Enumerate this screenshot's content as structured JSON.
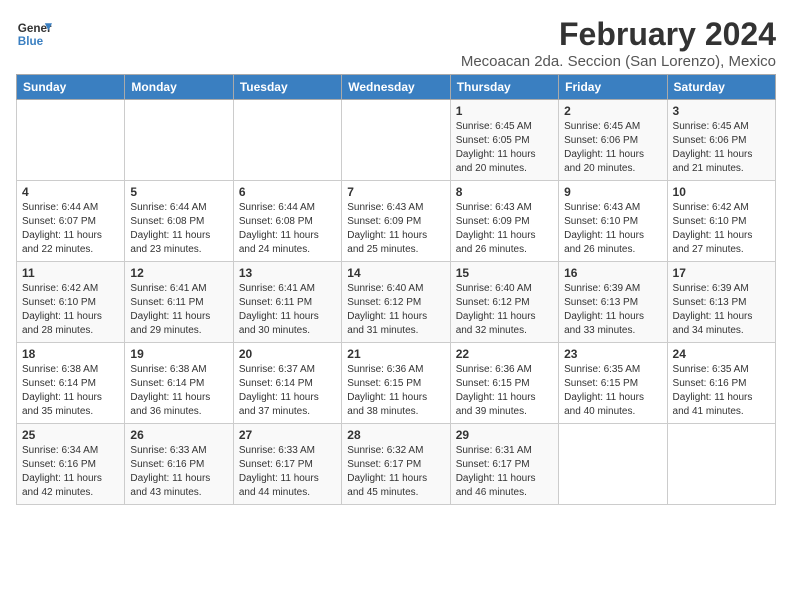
{
  "logo": {
    "line1": "General",
    "line2": "Blue"
  },
  "title": "February 2024",
  "subtitle": "Mecoacan 2da. Seccion (San Lorenzo), Mexico",
  "days_of_week": [
    "Sunday",
    "Monday",
    "Tuesday",
    "Wednesday",
    "Thursday",
    "Friday",
    "Saturday"
  ],
  "weeks": [
    [
      {
        "day": "",
        "info": ""
      },
      {
        "day": "",
        "info": ""
      },
      {
        "day": "",
        "info": ""
      },
      {
        "day": "",
        "info": ""
      },
      {
        "day": "1",
        "info": "Sunrise: 6:45 AM\nSunset: 6:05 PM\nDaylight: 11 hours\nand 20 minutes."
      },
      {
        "day": "2",
        "info": "Sunrise: 6:45 AM\nSunset: 6:06 PM\nDaylight: 11 hours\nand 20 minutes."
      },
      {
        "day": "3",
        "info": "Sunrise: 6:45 AM\nSunset: 6:06 PM\nDaylight: 11 hours\nand 21 minutes."
      }
    ],
    [
      {
        "day": "4",
        "info": "Sunrise: 6:44 AM\nSunset: 6:07 PM\nDaylight: 11 hours\nand 22 minutes."
      },
      {
        "day": "5",
        "info": "Sunrise: 6:44 AM\nSunset: 6:08 PM\nDaylight: 11 hours\nand 23 minutes."
      },
      {
        "day": "6",
        "info": "Sunrise: 6:44 AM\nSunset: 6:08 PM\nDaylight: 11 hours\nand 24 minutes."
      },
      {
        "day": "7",
        "info": "Sunrise: 6:43 AM\nSunset: 6:09 PM\nDaylight: 11 hours\nand 25 minutes."
      },
      {
        "day": "8",
        "info": "Sunrise: 6:43 AM\nSunset: 6:09 PM\nDaylight: 11 hours\nand 26 minutes."
      },
      {
        "day": "9",
        "info": "Sunrise: 6:43 AM\nSunset: 6:10 PM\nDaylight: 11 hours\nand 26 minutes."
      },
      {
        "day": "10",
        "info": "Sunrise: 6:42 AM\nSunset: 6:10 PM\nDaylight: 11 hours\nand 27 minutes."
      }
    ],
    [
      {
        "day": "11",
        "info": "Sunrise: 6:42 AM\nSunset: 6:10 PM\nDaylight: 11 hours\nand 28 minutes."
      },
      {
        "day": "12",
        "info": "Sunrise: 6:41 AM\nSunset: 6:11 PM\nDaylight: 11 hours\nand 29 minutes."
      },
      {
        "day": "13",
        "info": "Sunrise: 6:41 AM\nSunset: 6:11 PM\nDaylight: 11 hours\nand 30 minutes."
      },
      {
        "day": "14",
        "info": "Sunrise: 6:40 AM\nSunset: 6:12 PM\nDaylight: 11 hours\nand 31 minutes."
      },
      {
        "day": "15",
        "info": "Sunrise: 6:40 AM\nSunset: 6:12 PM\nDaylight: 11 hours\nand 32 minutes."
      },
      {
        "day": "16",
        "info": "Sunrise: 6:39 AM\nSunset: 6:13 PM\nDaylight: 11 hours\nand 33 minutes."
      },
      {
        "day": "17",
        "info": "Sunrise: 6:39 AM\nSunset: 6:13 PM\nDaylight: 11 hours\nand 34 minutes."
      }
    ],
    [
      {
        "day": "18",
        "info": "Sunrise: 6:38 AM\nSunset: 6:14 PM\nDaylight: 11 hours\nand 35 minutes."
      },
      {
        "day": "19",
        "info": "Sunrise: 6:38 AM\nSunset: 6:14 PM\nDaylight: 11 hours\nand 36 minutes."
      },
      {
        "day": "20",
        "info": "Sunrise: 6:37 AM\nSunset: 6:14 PM\nDaylight: 11 hours\nand 37 minutes."
      },
      {
        "day": "21",
        "info": "Sunrise: 6:36 AM\nSunset: 6:15 PM\nDaylight: 11 hours\nand 38 minutes."
      },
      {
        "day": "22",
        "info": "Sunrise: 6:36 AM\nSunset: 6:15 PM\nDaylight: 11 hours\nand 39 minutes."
      },
      {
        "day": "23",
        "info": "Sunrise: 6:35 AM\nSunset: 6:15 PM\nDaylight: 11 hours\nand 40 minutes."
      },
      {
        "day": "24",
        "info": "Sunrise: 6:35 AM\nSunset: 6:16 PM\nDaylight: 11 hours\nand 41 minutes."
      }
    ],
    [
      {
        "day": "25",
        "info": "Sunrise: 6:34 AM\nSunset: 6:16 PM\nDaylight: 11 hours\nand 42 minutes."
      },
      {
        "day": "26",
        "info": "Sunrise: 6:33 AM\nSunset: 6:16 PM\nDaylight: 11 hours\nand 43 minutes."
      },
      {
        "day": "27",
        "info": "Sunrise: 6:33 AM\nSunset: 6:17 PM\nDaylight: 11 hours\nand 44 minutes."
      },
      {
        "day": "28",
        "info": "Sunrise: 6:32 AM\nSunset: 6:17 PM\nDaylight: 11 hours\nand 45 minutes."
      },
      {
        "day": "29",
        "info": "Sunrise: 6:31 AM\nSunset: 6:17 PM\nDaylight: 11 hours\nand 46 minutes."
      },
      {
        "day": "",
        "info": ""
      },
      {
        "day": "",
        "info": ""
      }
    ]
  ]
}
